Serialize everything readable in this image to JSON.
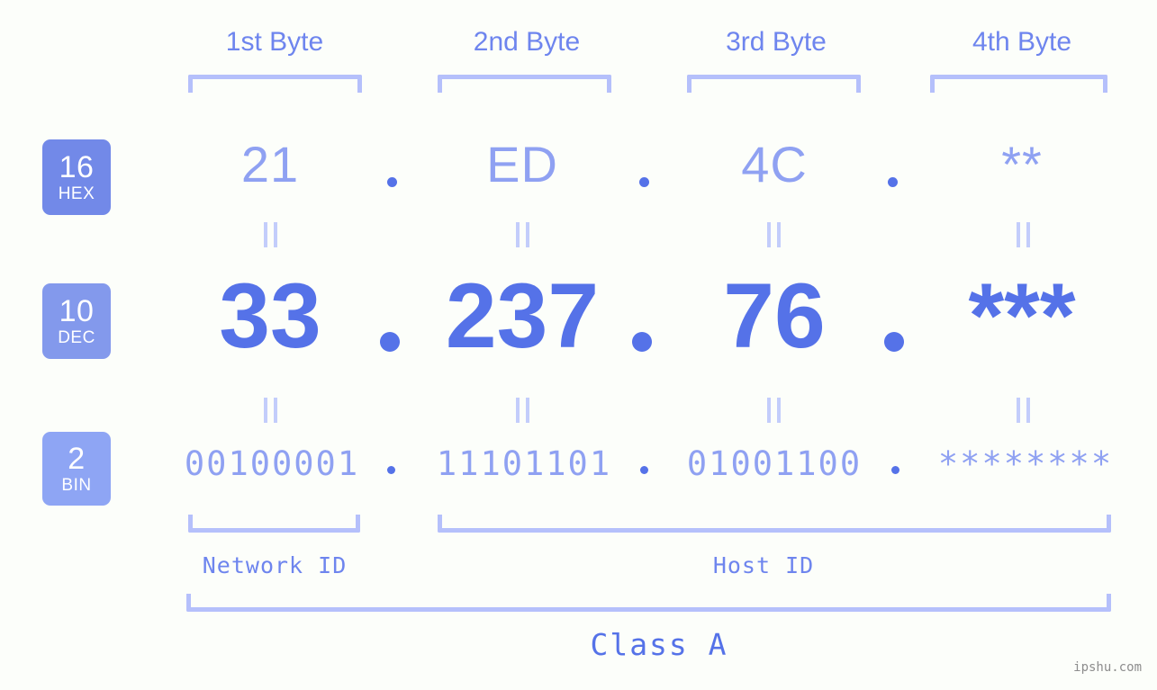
{
  "colors": {
    "background": "#fcfefa",
    "accent_strong": "#5572e8",
    "accent_mid": "#6e85ee",
    "accent_light": "#8fa1f2",
    "bracket": "#b5c0fb",
    "badge_hex": "#7289e8",
    "badge_dec": "#8399ec",
    "badge_bin": "#8ea5f4",
    "watermark": "#8d8d8d"
  },
  "byte_headers": [
    {
      "label": "1st Byte"
    },
    {
      "label": "2nd Byte"
    },
    {
      "label": "3rd Byte"
    },
    {
      "label": "4th Byte"
    }
  ],
  "rows": {
    "hex": {
      "badge_number": "16",
      "badge_name": "HEX",
      "values": [
        "21",
        "ED",
        "4C",
        "**"
      ]
    },
    "dec": {
      "badge_number": "10",
      "badge_name": "DEC",
      "values": [
        "33",
        "237",
        "76",
        "***"
      ]
    },
    "bin": {
      "badge_number": "2",
      "badge_name": "BIN",
      "values": [
        "00100001",
        "11101101",
        "01001100",
        "********"
      ]
    }
  },
  "separators": {
    "dot": ".",
    "equals": "="
  },
  "id_labels": {
    "network": "Network ID",
    "host": "Host ID"
  },
  "class_label": "Class A",
  "watermark": "ipshu.com"
}
